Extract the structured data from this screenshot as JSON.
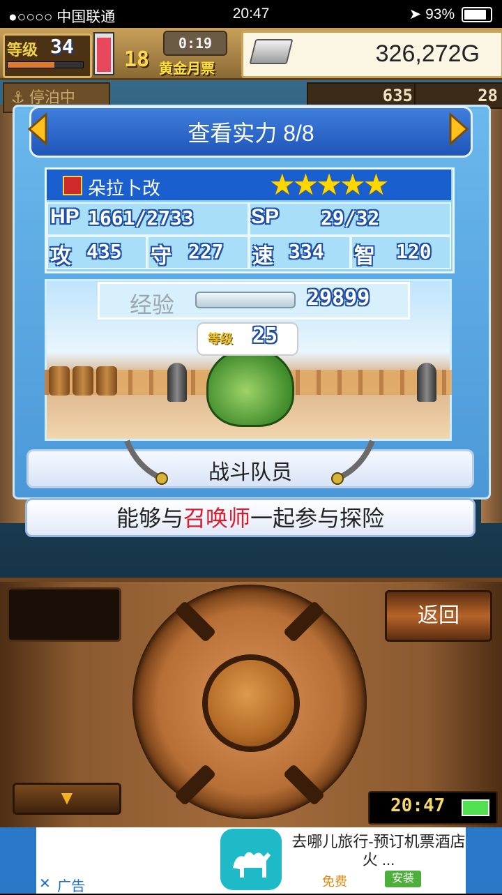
{
  "status_bar": {
    "carrier": "●○○○○ 中国联通",
    "time": "20:47",
    "battery": "93%"
  },
  "hud": {
    "level_label": "等级",
    "level": "34",
    "level_progress": 0.62,
    "fuel_level": 0.85,
    "moon_count": "18",
    "moon_timer": "0:19",
    "moon_label": "黄金月票",
    "gold": "326,272G",
    "docked": "停泊中",
    "resource_1": "635",
    "resource_2": "28"
  },
  "panel": {
    "title": "查看实力 8/8",
    "name": "朵拉卜改",
    "stars": "★★★★★",
    "hp_label": "HP",
    "hp_value": "1661/2733",
    "sp_label": "SP",
    "sp_value": "29/32",
    "atk_label": "攻",
    "atk_value": "435",
    "def_label": "守",
    "def_value": "227",
    "spd_label": "速",
    "spd_value": "334",
    "int_label": "智",
    "int_value": "120",
    "exp_label": "经验",
    "exp_value": "29899",
    "level_label": "等级",
    "level_value": "25",
    "role": "战斗队员",
    "desc_prefix": "能够与",
    "desc_highlight": "召唤师",
    "desc_suffix": "一起参与探险"
  },
  "controller": {
    "back_label": "返回",
    "down_arrow": "▼",
    "clock": "20:47"
  },
  "ad": {
    "title": "去哪儿旅行-预订机票酒店火 ...",
    "free": "免费",
    "install": "安装",
    "close": "✕",
    "label": "广告"
  },
  "colors": {
    "accent_blue": "#1a5fd0",
    "highlight_red": "#e0192a",
    "star": "#ffd700"
  }
}
